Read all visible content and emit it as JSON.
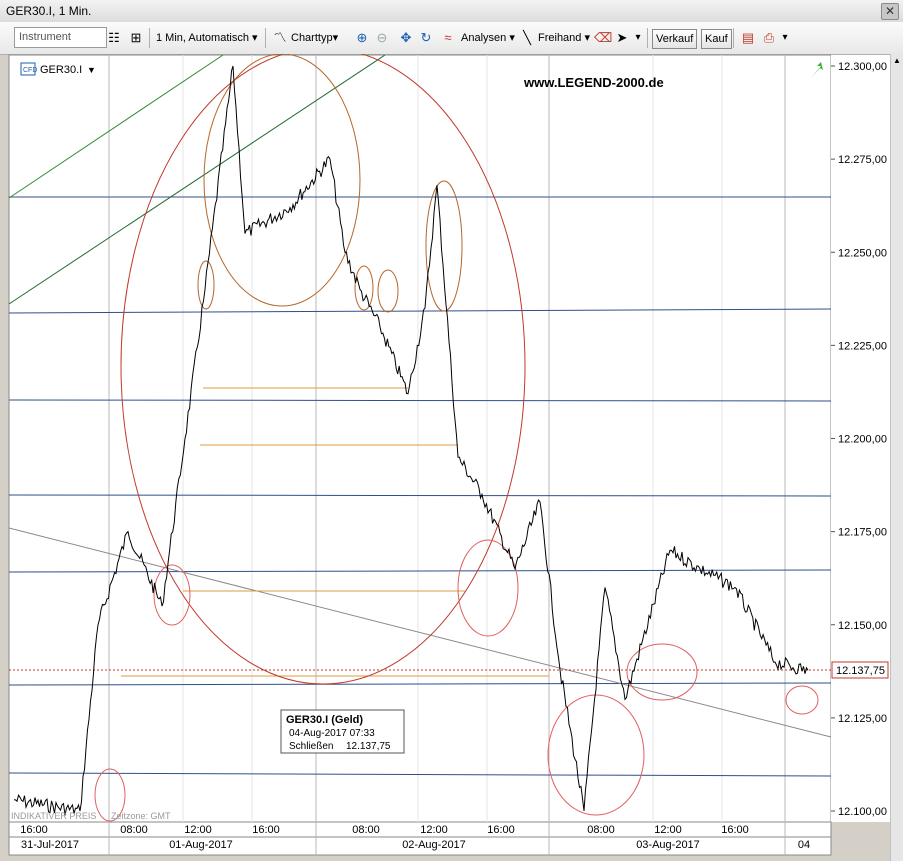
{
  "window": {
    "title": "GER30.I, 1 Min.",
    "close_label": "✕"
  },
  "toolbar": {
    "instrument_placeholder": "Instrument",
    "interval_label": "1 Min, Automatisch",
    "charttyp_label": "Charttyp",
    "analysen_label": "Analysen",
    "freihand_label": "Freihand",
    "verkauf_label": "Verkauf",
    "kauf_label": "Kauf"
  },
  "chart": {
    "symbol": "GER30.I",
    "watermark": "www.LEGEND-2000.de",
    "current_price_label": "12.137,75",
    "y_ticks": [
      "12.300,00",
      "12.275,00",
      "12.250,00",
      "12.225,00",
      "12.200,00",
      "12.175,00",
      "12.150,00",
      "12.125,00",
      "12.100,00"
    ],
    "x_time_ticks": [
      "16:00",
      "08:00",
      "12:00",
      "16:00",
      "08:00",
      "12:00",
      "16:00",
      "08:00",
      "12:00",
      "16:00"
    ],
    "x_date_ticks": [
      "31-Jul-2017",
      "01-Aug-2017",
      "02-Aug-2017",
      "03-Aug-2017",
      "04"
    ],
    "footer_left": "INDIKATIVER PREIS",
    "footer_tz": "Zeitzone: GMT",
    "tooltip": {
      "title": "GER30.I (Geld)",
      "datetime": "04-Aug-2017 07:33",
      "close_label": "Schließen",
      "close_value": "12.137,75"
    },
    "colors": {
      "grid_h": "#2f4f8a",
      "price_line": "#000000",
      "annotation_circle": "#d9534f",
      "support_line": "#e39a3c",
      "trend_green": "#2e8b2e",
      "trend_gray": "#808080"
    }
  },
  "chart_data": {
    "type": "line",
    "title": "GER30.I, 1 Min.",
    "xlabel": "",
    "ylabel": "",
    "ylim": [
      12095,
      12305
    ],
    "x": [
      "31-Jul-2017 16:00",
      "01-Aug-2017 07:00",
      "01-Aug-2017 08:00",
      "01-Aug-2017 09:00",
      "01-Aug-2017 10:00",
      "01-Aug-2017 11:00",
      "01-Aug-2017 12:00",
      "01-Aug-2017 13:00",
      "01-Aug-2017 14:00",
      "01-Aug-2017 16:00",
      "01-Aug-2017 18:00",
      "02-Aug-2017 07:00",
      "02-Aug-2017 08:00",
      "02-Aug-2017 09:00",
      "02-Aug-2017 10:00",
      "02-Aug-2017 11:00",
      "02-Aug-2017 12:00",
      "02-Aug-2017 13:00",
      "02-Aug-2017 14:00",
      "02-Aug-2017 16:00",
      "02-Aug-2017 18:00",
      "03-Aug-2017 07:00",
      "03-Aug-2017 08:00",
      "03-Aug-2017 09:00",
      "03-Aug-2017 10:00",
      "03-Aug-2017 12:00",
      "03-Aug-2017 14:00",
      "03-Aug-2017 16:00",
      "03-Aug-2017 18:00",
      "04-Aug-2017 07:33"
    ],
    "series": [
      {
        "name": "GER30.I",
        "values": [
          12103,
          12100,
          12150,
          12175,
          12155,
          12200,
          12240,
          12300,
          12255,
          12262,
          12275,
          12250,
          12240,
          12230,
          12212,
          12235,
          12268,
          12195,
          12185,
          12165,
          12183,
          12138,
          12100,
          12160,
          12130,
          12170,
          12165,
          12160,
          12140,
          12137.75
        ]
      }
    ]
  }
}
